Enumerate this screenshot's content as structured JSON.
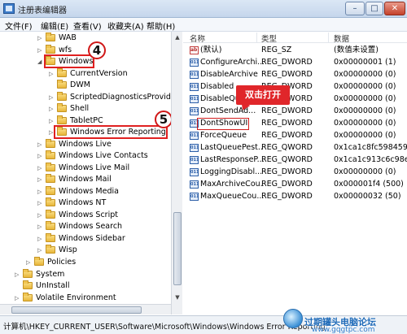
{
  "window": {
    "title": "注册表编辑器",
    "min_glyph": "–",
    "max_glyph": "□",
    "close_glyph": "✕"
  },
  "menu": [
    "文件(F)",
    "编辑(E)",
    "查看(V)",
    "收藏夹(A)",
    "帮助(H)"
  ],
  "tree": [
    {
      "label": "WAB",
      "expander": "▷"
    },
    {
      "label": "wfs",
      "expander": "▷"
    },
    {
      "label": "Windows",
      "expander": "◢"
    },
    {
      "label": "CurrentVersion",
      "expander": "▷"
    },
    {
      "label": "DWM",
      "expander": ""
    },
    {
      "label": "ScriptedDiagnosticsProvider",
      "expander": "▷"
    },
    {
      "label": "Shell",
      "expander": "▷"
    },
    {
      "label": "TabletPC",
      "expander": "▷"
    },
    {
      "label": "Windows Error Reporting",
      "expander": "▷"
    },
    {
      "label": "Windows Live",
      "expander": "▷"
    },
    {
      "label": "Windows Live Contacts",
      "expander": "▷"
    },
    {
      "label": "Windows Live Mail",
      "expander": "▷"
    },
    {
      "label": "Windows Mail",
      "expander": "▷"
    },
    {
      "label": "Windows Media",
      "expander": "▷"
    },
    {
      "label": "Windows NT",
      "expander": "▷"
    },
    {
      "label": "Windows Script",
      "expander": "▷"
    },
    {
      "label": "Windows Search",
      "expander": "▷"
    },
    {
      "label": "Windows Sidebar",
      "expander": "▷"
    },
    {
      "label": "Wisp",
      "expander": "▷"
    },
    {
      "label": "Policies",
      "expander": "▷"
    },
    {
      "label": "System",
      "expander": "▷"
    },
    {
      "label": "UnInstall",
      "expander": ""
    },
    {
      "label": "Volatile Environment",
      "expander": "▷"
    }
  ],
  "badges": {
    "step4": "4",
    "step5": "5"
  },
  "list": {
    "headers": [
      "名称",
      "类型",
      "数据"
    ],
    "rows": [
      {
        "name": "(默认)",
        "type": "REG_SZ",
        "data": "(数值未设置)",
        "icon": "string-value-icon"
      },
      {
        "name": "ConfigureArchi...",
        "type": "REG_DWORD",
        "data": "0x00000001 (1)",
        "icon": "dword-value-icon"
      },
      {
        "name": "DisableArchive",
        "type": "REG_DWORD",
        "data": "0x00000000 (0)",
        "icon": "dword-value-icon"
      },
      {
        "name": "Disabled",
        "type": "REG_DWORD",
        "data": "0x00000000 (0)",
        "icon": "dword-value-icon"
      },
      {
        "name": "DisableQu...",
        "type": "REG_DWORD",
        "data": "0x00000000 (0)",
        "icon": "dword-value-icon"
      },
      {
        "name": "DontSendAd...",
        "type": "REG_DWORD",
        "data": "0x00000000 (0)",
        "icon": "dword-value-icon"
      },
      {
        "name": "DontShowUI",
        "type": "REG_DWORD",
        "data": "0x00000000 (0)",
        "icon": "dword-value-icon"
      },
      {
        "name": "ForceQueue",
        "type": "REG_DWORD",
        "data": "0x00000000 (0)",
        "icon": "dword-value-icon"
      },
      {
        "name": "LastQueuePest...",
        "type": "REG_QWORD",
        "data": "0x1ca1c8fc5984597",
        "icon": "dword-value-icon"
      },
      {
        "name": "LastResponseP...",
        "type": "REG_QWORD",
        "data": "0x1ca1c913c6c98ec",
        "icon": "dword-value-icon"
      },
      {
        "name": "LoggingDisabl...",
        "type": "REG_DWORD",
        "data": "0x00000000 (0)",
        "icon": "dword-value-icon"
      },
      {
        "name": "MaxArchiveCou...",
        "type": "REG_DWORD",
        "data": "0x000001f4 (500)",
        "icon": "dword-value-icon"
      },
      {
        "name": "MaxQueueCou...",
        "type": "REG_DWORD",
        "data": "0x00000032 (50)",
        "icon": "dword-value-icon"
      }
    ]
  },
  "callout": "双击打开",
  "status": "计算机\\HKEY_CURRENT_USER\\Software\\Microsoft\\Windows\\Windows Error Reporting",
  "watermark": {
    "name": "过期罐头电脑论坛",
    "url": "www.gqgtpc.com"
  }
}
